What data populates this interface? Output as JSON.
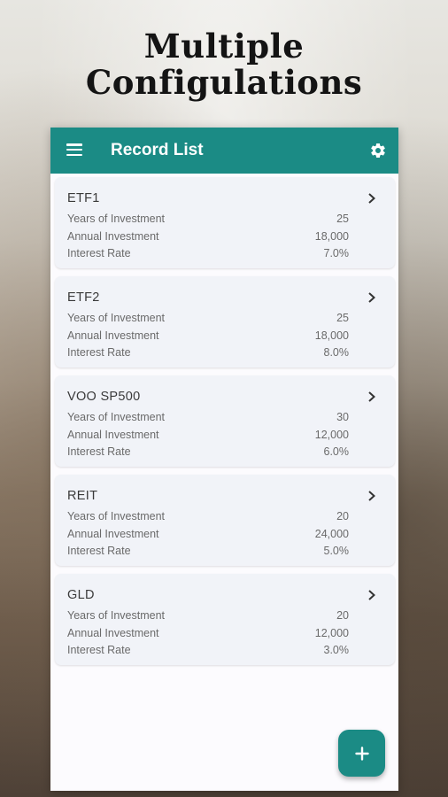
{
  "headline": {
    "line1": "Multiple",
    "line2": "Configulations"
  },
  "appbar": {
    "title": "Record List",
    "menu_icon": "menu-icon",
    "settings_icon": "gear-icon",
    "color": "#1b8b85"
  },
  "records": [
    {
      "name": "ETF1",
      "years_label": "Years of Investment",
      "years": "25",
      "annual_label": "Annual Investment",
      "annual": "18,000",
      "rate_label": "Interest Rate",
      "rate": "7.0%"
    },
    {
      "name": "ETF2",
      "years_label": "Years of Investment",
      "years": "25",
      "annual_label": "Annual Investment",
      "annual": "18,000",
      "rate_label": "Interest Rate",
      "rate": "8.0%"
    },
    {
      "name": "VOO SP500",
      "years_label": "Years of Investment",
      "years": "30",
      "annual_label": "Annual Investment",
      "annual": "12,000",
      "rate_label": "Interest Rate",
      "rate": "6.0%"
    },
    {
      "name": "REIT",
      "years_label": "Years of Investment",
      "years": "20",
      "annual_label": "Annual Investment",
      "annual": "24,000",
      "rate_label": "Interest Rate",
      "rate": "5.0%"
    },
    {
      "name": "GLD",
      "years_label": "Years of Investment",
      "years": "20",
      "annual_label": "Annual Investment",
      "annual": "12,000",
      "rate_label": "Interest Rate",
      "rate": "3.0%"
    }
  ],
  "fab": {
    "icon": "plus-icon"
  }
}
